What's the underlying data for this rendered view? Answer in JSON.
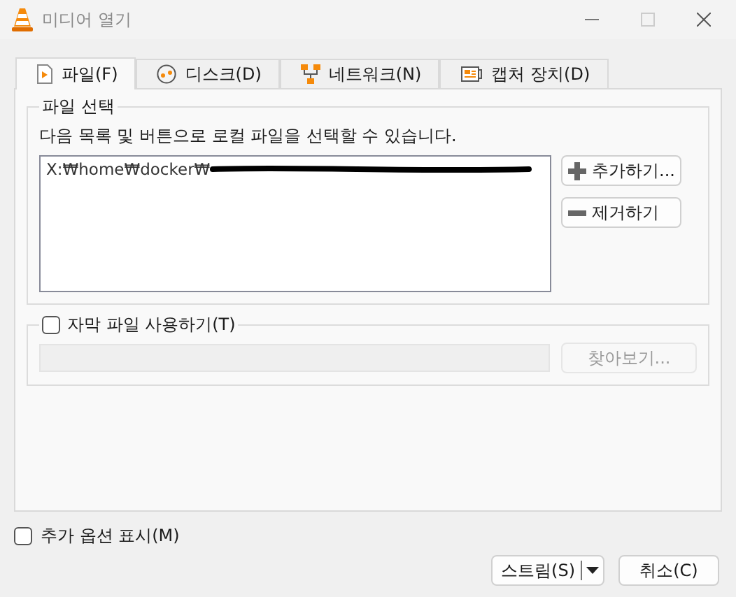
{
  "window": {
    "title": "미디어 열기"
  },
  "tabs": [
    {
      "label": "파일(F)",
      "kind": "file",
      "selected": true
    },
    {
      "label": "디스크(D)",
      "kind": "disc",
      "selected": false
    },
    {
      "label": "네트워크(N)",
      "kind": "network",
      "selected": false
    },
    {
      "label": "캡처 장치(D)",
      "kind": "capture",
      "selected": false
    }
  ],
  "file_selection": {
    "title": "파일 선택",
    "description": "다음 목록 및 버튼으로 로컬 파일을 선택할 수 있습니다.",
    "files": [
      "X:₩home₩docker₩"
    ],
    "add_button": "추가하기...",
    "remove_button": "제거하기"
  },
  "subtitles": {
    "label": "자막 파일 사용하기(T)",
    "checked": false,
    "browse_button": "찾아보기..."
  },
  "show_more_options": {
    "label": "추가 옵션 표시(M)",
    "checked": false
  },
  "buttons": {
    "primary": "스트림(S)",
    "cancel": "취소(C)"
  }
}
